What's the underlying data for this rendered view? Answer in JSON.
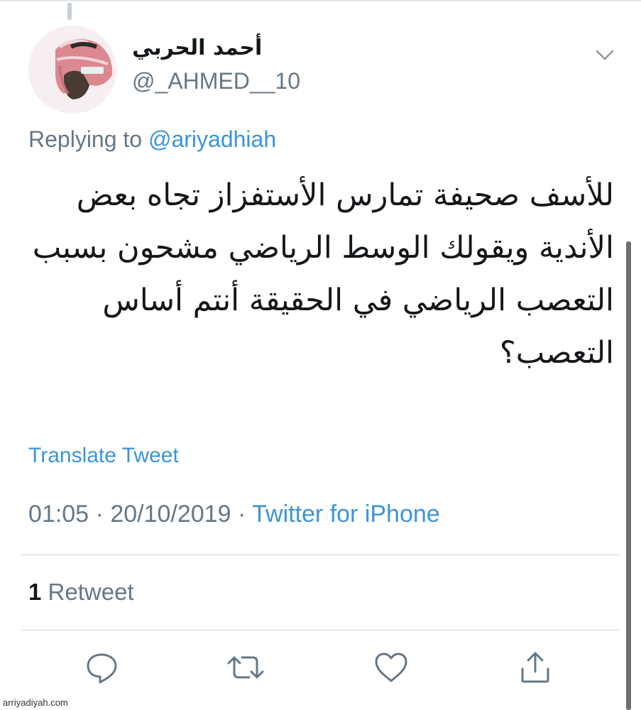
{
  "tweet": {
    "author": {
      "display_name": "أحمد الحربي",
      "handle": "@_AHMED__10",
      "avatar_icon": "profile-avatar"
    },
    "replying_prefix": "Replying to",
    "replying_to": "@ariyadhiah",
    "text": "للأسف صحيفة تمارس الأستفزاز تجاه بعض الأندية ويقولك الوسط الرياضي مشحون بسبب التعصب الرياضي في الحقيقة أنتم أساس التعصب؟",
    "translate_label": "Translate Tweet",
    "time": "01:05",
    "date": "20/10/2019",
    "separator": "·",
    "source": "Twitter for iPhone",
    "retweet_count": "1",
    "retweet_label": "Retweet",
    "actions": [
      {
        "name": "reply",
        "icon": "reply-icon"
      },
      {
        "name": "retweet",
        "icon": "retweet-icon"
      },
      {
        "name": "like",
        "icon": "heart-icon"
      },
      {
        "name": "share",
        "icon": "share-icon"
      }
    ]
  },
  "watermark": "arriyadiyah.com",
  "colors": {
    "text_primary": "#14171a",
    "text_secondary": "#657786",
    "link": "#3b94d9",
    "divider": "#cfd9de",
    "icon": "#657786"
  }
}
